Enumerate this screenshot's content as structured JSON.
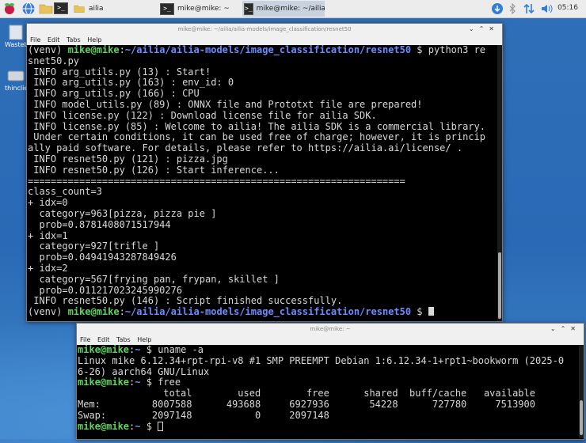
{
  "taskbar": {
    "tasks": [
      {
        "label": "ailia"
      },
      {
        "label": "mike@mike: ~"
      },
      {
        "label": "mike@mike: ~/ailia/..."
      }
    ],
    "clock": "05:16"
  },
  "desktop": {
    "icons": [
      {
        "label": "Wastebasket"
      },
      {
        "label": "thinclient_drives"
      }
    ]
  },
  "window1": {
    "title": "mike@mike: ~/ailia/ailia-models/image_classification/resnet50",
    "menu": [
      "File",
      "Edit",
      "Tabs",
      "Help"
    ],
    "prompt": {
      "venv": "(venv) ",
      "user": "mike@mike",
      "path": "~/ailia/ailia-models/image_classification/resnet50",
      "sym": " $ ",
      "cmd": "python3 re",
      "cmd2": "snet50.py"
    },
    "lines": [
      " INFO arg_utils.py (13) : Start!",
      " INFO arg_utils.py (163) : env_id: 0",
      " INFO arg_utils.py (166) : CPU",
      " INFO model_utils.py (89) : ONNX file and Prototxt file are prepared!",
      " INFO license.py (122) : Download license file for ailia SDK.",
      " INFO license.py (85) : Welcome to ailia! The ailia SDK is a commercial library.",
      " Under certain conditions, it can be used free of charge; however, it is princip",
      "ally paid software. For details, please refer to https://ailia.ai/license/ .",
      " INFO resnet50.py (121) : pizza.jpg",
      " INFO resnet50.py (126) : Start inference...",
      "==================================================================",
      "class_count=3",
      "+ idx=0",
      "  category=963[pizza, pizza pie ]",
      "  prob=0.8781408071517944",
      "+ idx=1",
      "  category=927[trifle ]",
      "  prob=0.04941943287849426",
      "+ idx=2",
      "  category=567[frying pan, frypan, skillet ]",
      "  prob=0.011217023245990276",
      " INFO resnet50.py (146) : Script finished successfully."
    ]
  },
  "window2": {
    "title": "mike@mike: ~",
    "menu": [
      "File",
      "Edit",
      "Tabs",
      "Help"
    ],
    "user": "mike@mike",
    "path": "~",
    "sym": " $ ",
    "cmd1": "uname -a",
    "out1": "Linux mike 6.12.34+rpt-rpi-v8 #1 SMP PREEMPT Debian 1:6.12.34-1+rpt1~bookworm (2025-0",
    "out2": "6-26) aarch64 GNU/Linux",
    "cmd2": "free",
    "free_header": "               total        used        free      shared  buff/cache   available",
    "free_mem": "Mem:         8007588      493688     6927936       54228      727780     7513900",
    "free_swap": "Swap:        2097148           0     2097148"
  }
}
